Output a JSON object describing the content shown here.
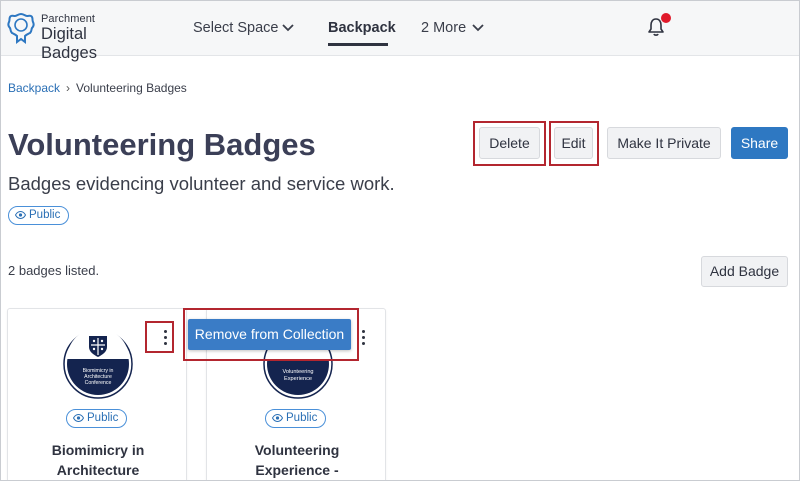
{
  "nav": {
    "logo_small": "Parchment",
    "logo_big": "Digital Badges",
    "select_space": "Select Space",
    "backpack": "Backpack",
    "more": "2 More"
  },
  "breadcrumb": {
    "root": "Backpack",
    "current": "Volunteering Badges"
  },
  "collection": {
    "title": "Volunteering Badges",
    "description": "Badges evidencing volunteer and service work.",
    "visibility": "Public",
    "count_text": "2 badges listed."
  },
  "actions": {
    "delete": "Delete",
    "edit": "Edit",
    "make_private": "Make It Private",
    "share": "Share",
    "add_badge": "Add Badge"
  },
  "context_menu": {
    "remove": "Remove from Collection"
  },
  "badges": [
    {
      "title": "Biomimicry in Architecture",
      "image_text": [
        "Biomimicry in",
        "Architecture",
        "Conference"
      ],
      "visibility": "Public"
    },
    {
      "title": "Volunteering Experience -",
      "image_text": [
        "Volunteering",
        "Experience"
      ],
      "visibility": "Public"
    }
  ],
  "colors": {
    "accent": "#2e78c2",
    "highlight": "#b3262f",
    "notification": "#e0192a",
    "badge_navy": "#14244f"
  }
}
